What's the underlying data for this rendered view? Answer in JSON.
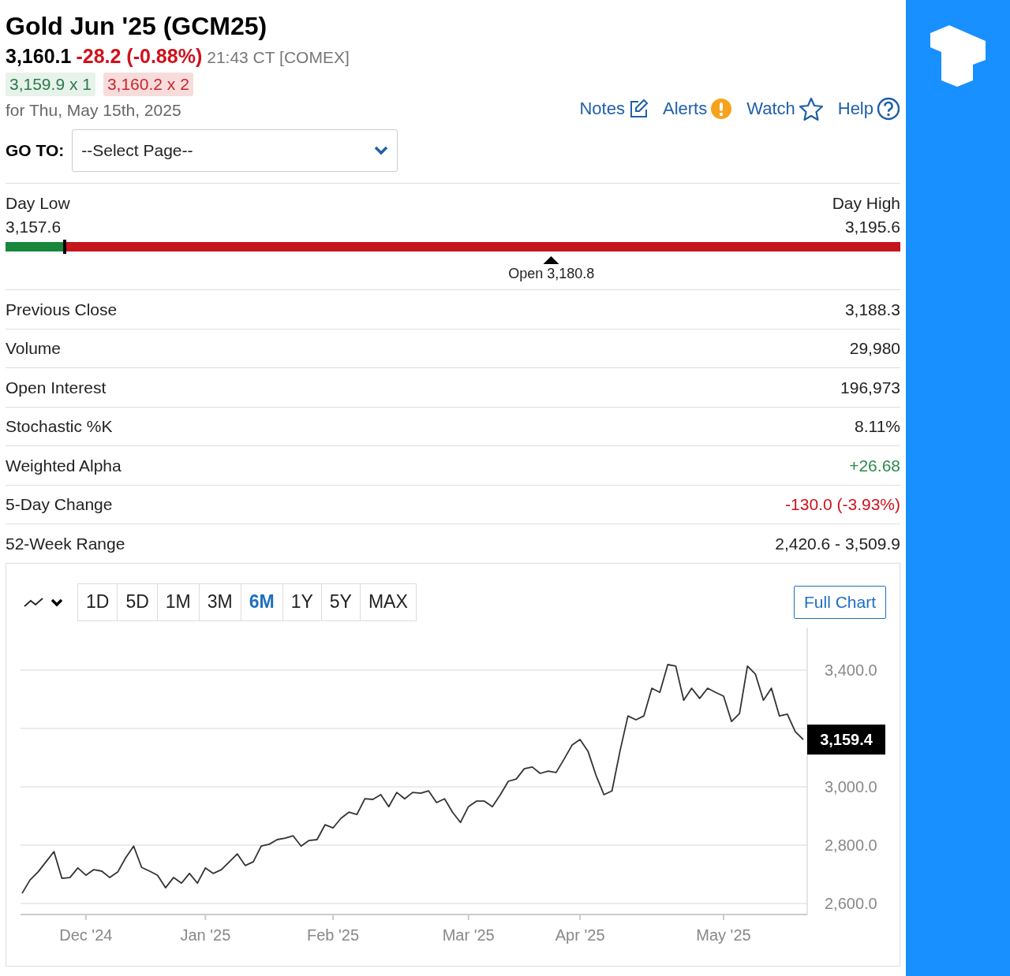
{
  "header": {
    "title": "Gold Jun '25 (GCM25)",
    "last": "3,160.1",
    "change": "-28.2 (-0.88%)",
    "time": "21:43 CT [COMEX]",
    "bid": "3,159.9 x 1",
    "ask": "3,160.2 x 2",
    "date": "for Thu, May 15th, 2025"
  },
  "actions": [
    {
      "label": "Notes",
      "kind": "notes"
    },
    {
      "label": "Alerts",
      "kind": "alerts"
    },
    {
      "label": "Watch",
      "kind": "watch"
    },
    {
      "label": "Help",
      "kind": "help"
    }
  ],
  "goto": {
    "label": "GO TO:",
    "value": "--Select Page--"
  },
  "day_range": {
    "low_label": "Day Low",
    "low": "3,157.6",
    "high_label": "Day High",
    "high": "3,195.6",
    "level": 0.066,
    "open": {
      "label": "Open 3,180.8",
      "level": 0.61
    }
  },
  "stats": [
    {
      "label": "Previous Close",
      "value": "3,188.3",
      "color": "#222222"
    },
    {
      "label": "Volume",
      "value": "29,980",
      "color": "#222222"
    },
    {
      "label": "Open Interest",
      "value": "196,973",
      "color": "#222222"
    },
    {
      "label": "Stochastic %K",
      "value": "8.11%",
      "color": "#222222"
    },
    {
      "label": "Weighted Alpha",
      "value": "+26.68",
      "color": "#2a8a4a"
    },
    {
      "label": "5-Day Change",
      "value": "-130.0 (-3.93%)",
      "color": "#d0111b"
    },
    {
      "label": "52-Week Range",
      "value": "2,420.6 - 3,509.9",
      "color": "#222222"
    }
  ],
  "chart_panel": {
    "ranges": [
      {
        "label": "1D",
        "selected": false
      },
      {
        "label": "5D",
        "selected": false
      },
      {
        "label": "1M",
        "selected": false
      },
      {
        "label": "3M",
        "selected": false
      },
      {
        "label": "6M",
        "selected": true
      },
      {
        "label": "1Y",
        "selected": false
      },
      {
        "label": "5Y",
        "selected": false
      },
      {
        "label": "MAX",
        "selected": false
      }
    ],
    "full_chart": "Full Chart",
    "last_price": "3,159.4",
    "chart_data": {
      "type": "line",
      "grid": true,
      "ylim": [
        2565,
        3545
      ],
      "categories": [
        null,
        null,
        null,
        null,
        null,
        null,
        null,
        null,
        "Dec '24",
        null,
        null,
        null,
        null,
        null,
        null,
        null,
        null,
        null,
        null,
        null,
        null,
        null,
        null,
        "Jan '25",
        null,
        null,
        null,
        null,
        null,
        null,
        null,
        null,
        null,
        null,
        null,
        null,
        null,
        null,
        null,
        "Feb '25",
        null,
        null,
        null,
        null,
        null,
        null,
        null,
        null,
        null,
        null,
        null,
        null,
        null,
        null,
        null,
        null,
        "Mar '25",
        null,
        null,
        null,
        null,
        null,
        null,
        null,
        null,
        null,
        null,
        null,
        null,
        null,
        "Apr '25",
        null,
        null,
        null,
        null,
        null,
        null,
        null,
        null,
        null,
        null,
        null,
        null,
        null,
        null,
        null,
        null,
        null,
        "May '25",
        null,
        null,
        null,
        null,
        null,
        null,
        null,
        null,
        null,
        null
      ],
      "yticks": [
        {
          "value": 2600,
          "label": "2,600.0"
        },
        {
          "value": 2800,
          "label": "2,800.0"
        },
        {
          "value": 3000,
          "label": "3,000.0"
        },
        {
          "value": 3400,
          "label": "3,400.0"
        }
      ],
      "series": [
        {
          "color": "#333333",
          "values": [
            2635,
            2681,
            2708,
            2743,
            2778,
            2686,
            2689,
            2722,
            2697,
            2716,
            2711,
            2689,
            2708,
            2757,
            2797,
            2724,
            2711,
            2697,
            2654,
            2689,
            2670,
            2703,
            2670,
            2722,
            2703,
            2716,
            2743,
            2770,
            2730,
            2743,
            2797,
            2803,
            2819,
            2824,
            2832,
            2797,
            2816,
            2819,
            2870,
            2859,
            2892,
            2913,
            2905,
            2959,
            2957,
            2973,
            2932,
            2981,
            2959,
            2981,
            2978,
            2986,
            2946,
            2959,
            2913,
            2878,
            2932,
            2951,
            2951,
            2932,
            2973,
            3019,
            3027,
            3062,
            3068,
            3046,
            3054,
            3049,
            3095,
            3143,
            3162,
            3122,
            3040,
            2973,
            2986,
            3122,
            3243,
            3230,
            3243,
            3338,
            3324,
            3419,
            3414,
            3297,
            3338,
            3303,
            3338,
            3324,
            3311,
            3224,
            3251,
            3414,
            3386,
            3297,
            3338,
            3243,
            3249,
            3189,
            3162
          ]
        }
      ]
    }
  }
}
